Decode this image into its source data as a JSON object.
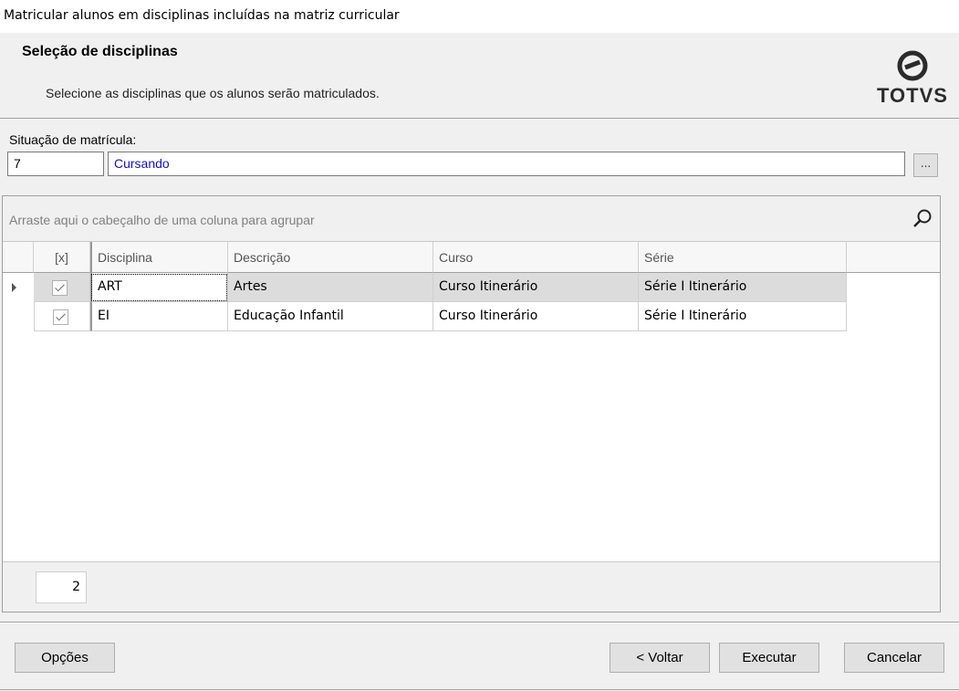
{
  "window": {
    "title": "Matricular alunos em disciplinas incluídas na matriz curricular"
  },
  "header": {
    "title": "Seleção de disciplinas",
    "subtitle": "Selecione as disciplinas que os alunos serão matriculados.",
    "logo_text": "TOTVS"
  },
  "situacao": {
    "label": "Situação de matrícula:",
    "code": "7",
    "description": "Cursando",
    "lookup_label": "..."
  },
  "grid": {
    "group_hint": "Arraste aqui o cabeçalho de uma coluna para agrupar",
    "columns": [
      "[x]",
      "Disciplina",
      "Descrição",
      "Curso",
      "Série"
    ],
    "rows": [
      {
        "checked": true,
        "disciplina": "ART",
        "descricao": "Artes",
        "curso": "Curso Itinerário",
        "serie": "Série I Itinerário"
      },
      {
        "checked": true,
        "disciplina": "EI",
        "descricao": "Educação Infantil",
        "curso": "Curso Itinerário",
        "serie": "Série I Itinerário"
      }
    ],
    "count": "2"
  },
  "buttons": {
    "options": "Opções",
    "back": "< Voltar",
    "execute": "Executar",
    "cancel": "Cancelar"
  },
  "colors": {
    "link_blue": "#1010d0",
    "selected_row": "#dcdcdc",
    "panel_bg": "#f0f0f0"
  }
}
